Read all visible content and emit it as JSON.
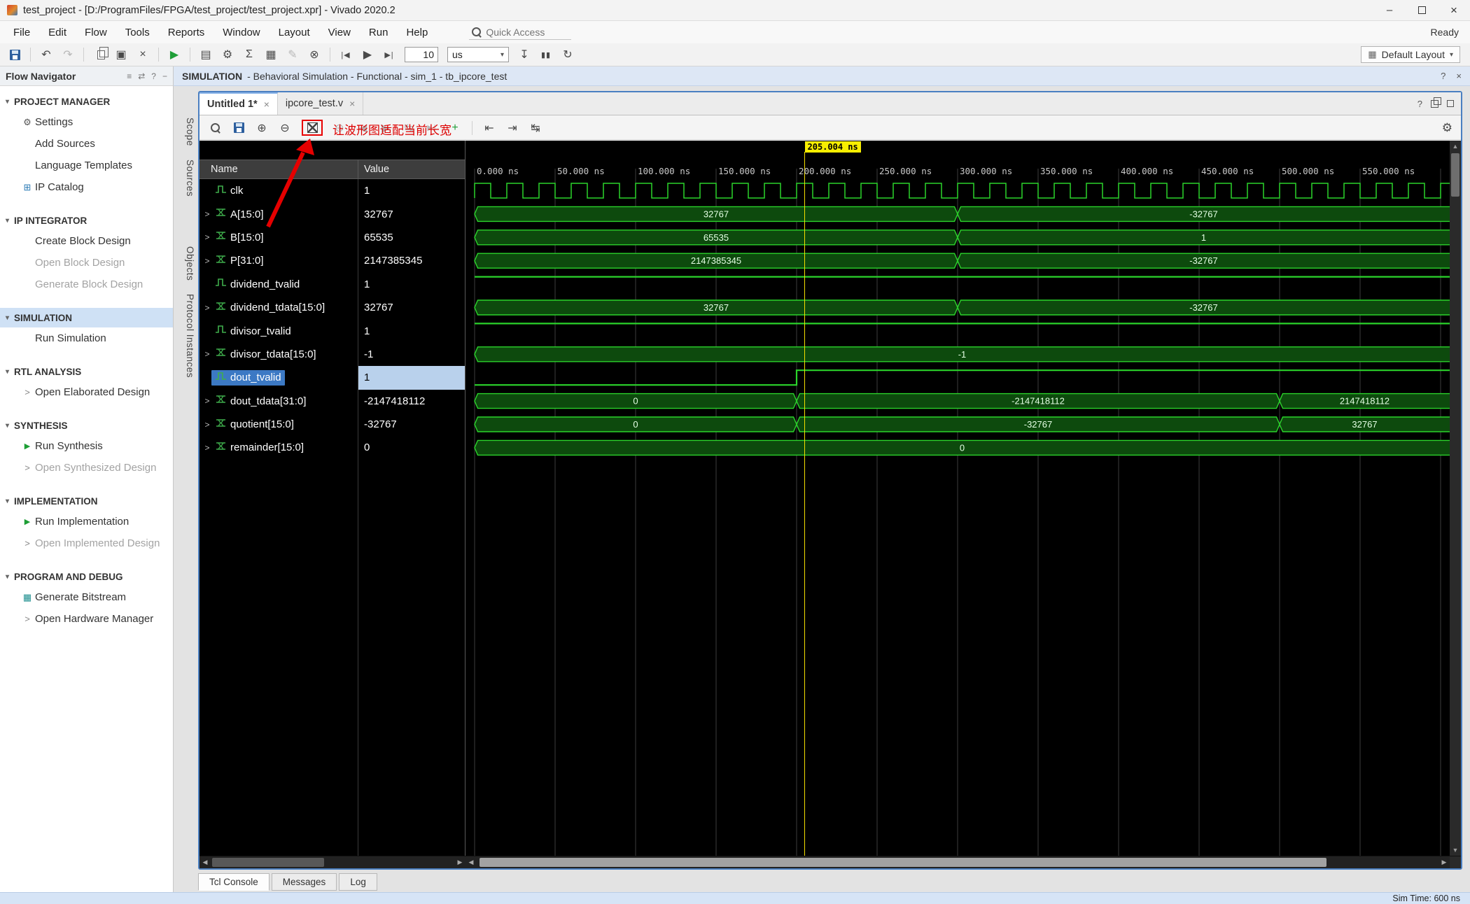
{
  "glyphs": {
    "minimize": "–",
    "close": "×",
    "help": "?",
    "undo": "↶",
    "redo": "↷",
    "paste": "▣",
    "delete": "×",
    "play": "▶",
    "gear": "⚙",
    "sigma": "Σ",
    "dashboard": "▤",
    "grid": "▦",
    "pencil": "✎",
    "probe": "⊗",
    "restart": "|◀",
    "run_all": "▶",
    "run_for": "▶|",
    "step": "↧",
    "pause": "▮▮",
    "relaunch": "↻",
    "zoom_in": "⊕",
    "zoom_out": "⊖",
    "plus": "+",
    "prev_transition": "⇤",
    "next_transition": "⇥",
    "swap": "↹",
    "chevron_right": ">",
    "section_chevron": "▾",
    "dropdown": "▾",
    "left_arrow": "◀",
    "right_arrow": "▶",
    "up_arrow": "▲",
    "down_arrow": "▼",
    "reorder": "≡",
    "exchange": "⇄",
    "dash": "−"
  },
  "window": {
    "title": "test_project - [D:/ProgramFiles/FPGA/test_project/test_project.xpr] - Vivado 2020.2",
    "ready": "Ready"
  },
  "menu": {
    "items": [
      "File",
      "Edit",
      "Flow",
      "Tools",
      "Reports",
      "Window",
      "Layout",
      "View",
      "Run",
      "Help"
    ]
  },
  "quick_access": {
    "placeholder": "Quick Access"
  },
  "toolbar": {
    "run_time_value": "10",
    "run_time_unit": "us",
    "layout": "Default Layout"
  },
  "context_bar": {
    "title": "SIMULATION",
    "subtitle": "- Behavioral Simulation - Functional - sim_1 - tb_ipcore_test"
  },
  "flow_navigator": {
    "title": "Flow Navigator",
    "sections": [
      {
        "label": "PROJECT MANAGER",
        "selected": false,
        "items": [
          {
            "label": "Settings",
            "icon": "gear",
            "enabled": true
          },
          {
            "label": "Add Sources",
            "icon": "none",
            "enabled": true
          },
          {
            "label": "Language Templates",
            "icon": "none",
            "enabled": true
          },
          {
            "label": "IP Catalog",
            "icon": "ip",
            "enabled": true
          }
        ]
      },
      {
        "label": "IP INTEGRATOR",
        "selected": false,
        "items": [
          {
            "label": "Create Block Design",
            "icon": "none",
            "enabled": true
          },
          {
            "label": "Open Block Design",
            "icon": "none",
            "enabled": false
          },
          {
            "label": "Generate Block Design",
            "icon": "none",
            "enabled": false
          }
        ]
      },
      {
        "label": "SIMULATION",
        "selected": true,
        "items": [
          {
            "label": "Run Simulation",
            "icon": "none",
            "enabled": true
          }
        ]
      },
      {
        "label": "RTL ANALYSIS",
        "selected": false,
        "items": [
          {
            "label": "Open Elaborated Design",
            "icon": "chevron",
            "enabled": true
          }
        ]
      },
      {
        "label": "SYNTHESIS",
        "selected": false,
        "items": [
          {
            "label": "Run Synthesis",
            "icon": "play",
            "enabled": true
          },
          {
            "label": "Open Synthesized Design",
            "icon": "chevron",
            "enabled": false
          }
        ]
      },
      {
        "label": "IMPLEMENTATION",
        "selected": false,
        "items": [
          {
            "label": "Run Implementation",
            "icon": "play",
            "enabled": true
          },
          {
            "label": "Open Implemented Design",
            "icon": "chevron",
            "enabled": false
          }
        ]
      },
      {
        "label": "PROGRAM AND DEBUG",
        "selected": false,
        "items": [
          {
            "label": "Generate Bitstream",
            "icon": "bitstream",
            "enabled": true
          },
          {
            "label": "Open Hardware Manager",
            "icon": "chevron",
            "enabled": true
          }
        ]
      }
    ]
  },
  "editor": {
    "tabs": [
      {
        "label": "Untitled 1*"
      },
      {
        "label": "ipcore_test.v"
      }
    ],
    "side_tabs": [
      "Scope",
      "Sources",
      "Objects",
      "Protocol Instances"
    ],
    "toolbar_annotation": "让波形图适配当前长宽",
    "wave_header": {
      "name": "Name",
      "value": "Value"
    },
    "bottom_tabs": [
      "Tcl Console",
      "Messages",
      "Log"
    ]
  },
  "status_bar": {
    "sim_time": "Sim Time: 600 ns"
  },
  "chart_data": {
    "type": "waveform",
    "time_unit": "ns",
    "t_start": 0,
    "t_end": 604,
    "major_tick_ns": 50,
    "tick_labels": [
      "0.000 ns",
      "50.000 ns",
      "100.000 ns",
      "150.000 ns",
      "200.000 ns",
      "250.000 ns",
      "300.000 ns",
      "350.000 ns",
      "400.000 ns",
      "450.000 ns",
      "500.000 ns",
      "550.000 ns"
    ],
    "cursor": {
      "time_ns": 205.004,
      "label": "205.004 ns"
    },
    "signals": [
      {
        "name": "clk",
        "value": "1",
        "kind": "clock",
        "period_ns": 20,
        "expandable": false,
        "selected": false
      },
      {
        "name": "A[15:0]",
        "value": "32767",
        "kind": "bus",
        "expandable": true,
        "selected": false,
        "segments": [
          {
            "t0": 0,
            "t1": 300,
            "label": "32767"
          },
          {
            "t0": 300,
            "t1": 604,
            "label": "-32767"
          }
        ]
      },
      {
        "name": "B[15:0]",
        "value": "65535",
        "kind": "bus",
        "expandable": true,
        "selected": false,
        "segments": [
          {
            "t0": 0,
            "t1": 300,
            "label": "65535"
          },
          {
            "t0": 300,
            "t1": 604,
            "label": "1"
          }
        ]
      },
      {
        "name": "P[31:0]",
        "value": "2147385345",
        "kind": "bus",
        "expandable": true,
        "selected": false,
        "segments": [
          {
            "t0": 0,
            "t1": 300,
            "label": "2147385345"
          },
          {
            "t0": 300,
            "t1": 604,
            "label": "-32767"
          }
        ]
      },
      {
        "name": "dividend_tvalid",
        "value": "1",
        "kind": "bit",
        "expandable": false,
        "selected": false,
        "levels": [
          {
            "t": 0,
            "v": 1
          }
        ]
      },
      {
        "name": "dividend_tdata[15:0]",
        "value": "32767",
        "kind": "bus",
        "expandable": true,
        "selected": false,
        "segments": [
          {
            "t0": 0,
            "t1": 300,
            "label": "32767"
          },
          {
            "t0": 300,
            "t1": 604,
            "label": "-32767"
          }
        ]
      },
      {
        "name": "divisor_tvalid",
        "value": "1",
        "kind": "bit",
        "expandable": false,
        "selected": false,
        "levels": [
          {
            "t": 0,
            "v": 1
          }
        ]
      },
      {
        "name": "divisor_tdata[15:0]",
        "value": "-1",
        "kind": "bus",
        "expandable": true,
        "selected": false,
        "segments": [
          {
            "t0": 0,
            "t1": 604,
            "label": "-1"
          }
        ]
      },
      {
        "name": "dout_tvalid",
        "value": "1",
        "kind": "bit",
        "expandable": false,
        "selected": true,
        "levels": [
          {
            "t": 0,
            "v": 0
          },
          {
            "t": 200,
            "v": 1
          }
        ]
      },
      {
        "name": "dout_tdata[31:0]",
        "value": "-2147418112",
        "kind": "bus",
        "expandable": true,
        "selected": false,
        "segments": [
          {
            "t0": 0,
            "t1": 200,
            "label": "0"
          },
          {
            "t0": 200,
            "t1": 500,
            "label": "-2147418112"
          },
          {
            "t0": 500,
            "t1": 604,
            "label": "2147418112"
          }
        ]
      },
      {
        "name": "quotient[15:0]",
        "value": "-32767",
        "kind": "bus",
        "expandable": true,
        "selected": false,
        "segments": [
          {
            "t0": 0,
            "t1": 200,
            "label": "0"
          },
          {
            "t0": 200,
            "t1": 500,
            "label": "-32767"
          },
          {
            "t0": 500,
            "t1": 604,
            "label": "32767"
          }
        ]
      },
      {
        "name": "remainder[15:0]",
        "value": "0",
        "kind": "bus",
        "expandable": true,
        "selected": false,
        "segments": [
          {
            "t0": 0,
            "t1": 604,
            "label": "0"
          }
        ]
      }
    ]
  }
}
